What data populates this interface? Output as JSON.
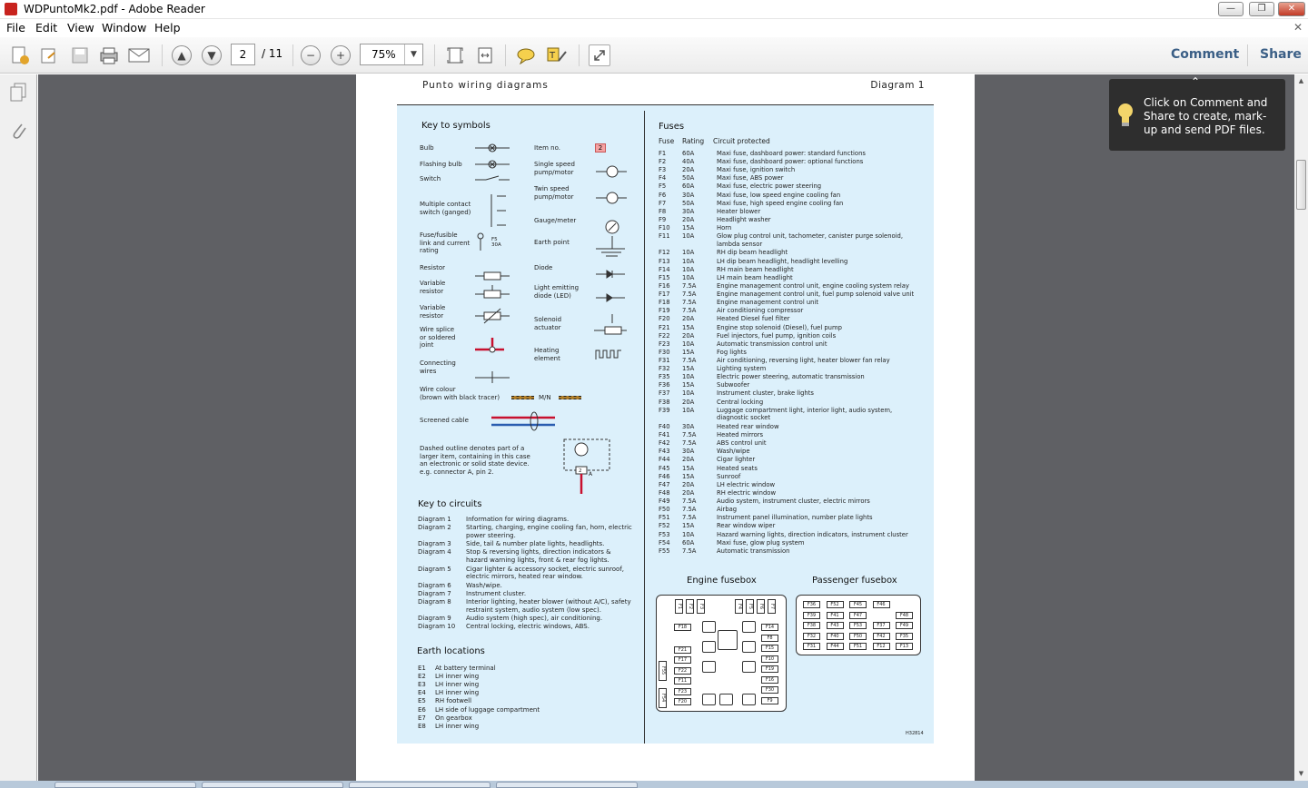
{
  "window": {
    "title": "WDPuntoMk2.pdf - Adobe Reader"
  },
  "menu": [
    "File",
    "Edit",
    "View",
    "Window",
    "Help"
  ],
  "toolbar": {
    "page_current": "2",
    "page_total": "/ 11",
    "zoom": "75%",
    "comment_label": "Comment",
    "share_label": "Share"
  },
  "tooltip": {
    "text": "Click on Comment and Share to create, mark-up and send PDF files."
  },
  "doc": {
    "header_left": "Punto  wiring  diagrams",
    "header_right": "Diagram 1",
    "key_symbols_title": "Key to symbols",
    "symbols_left": [
      "Bulb",
      "Flashing bulb",
      "Switch",
      "Multiple contact\nswitch (ganged)",
      "Fuse/fusible\nlink and current\nrating",
      "Resistor",
      "Variable\nresistor",
      "Variable\nresistor",
      "Wire splice\nor soldered\njoint",
      "Connecting\nwires",
      "Wire colour\n(brown with black tracer)",
      "Screened cable"
    ],
    "symbols_right": [
      "Item no.",
      "Single speed\npump/motor",
      "Twin speed\npump/motor",
      "Gauge/meter",
      "Earth point",
      "Diode",
      "Light emitting\ndiode (LED)",
      "Solenoid\nactuator",
      "Heating\nelement"
    ],
    "item_no_badge": "2",
    "fuse_symbol_label": "F5\n30A",
    "wire_colour_code": "M/N",
    "dashed_note": "Dashed outline denotes part of a\nlarger item, containing in this case\nan electronic or solid state device.\ne.g. connector A, pin 2.",
    "connector_pin": "2",
    "connector_letter": "A",
    "key_circuits_title": "Key to circuits",
    "circuits": [
      {
        "d": "Diagram 1",
        "t": "Information for wiring diagrams."
      },
      {
        "d": "Diagram 2",
        "t": "Starting, charging, engine cooling fan, horn, electric\npower steering."
      },
      {
        "d": "Diagram 3",
        "t": "Side, tail & number plate lights, headlights."
      },
      {
        "d": "Diagram 4",
        "t": "Stop & reversing lights, direction indicators &\nhazard warning lights, front & rear fog lights."
      },
      {
        "d": "Diagram 5",
        "t": "Cigar lighter & accessory socket, electric sunroof,\nelectric mirrors, heated rear window."
      },
      {
        "d": "Diagram 6",
        "t": "Wash/wipe."
      },
      {
        "d": "Diagram 7",
        "t": "Instrument cluster."
      },
      {
        "d": "Diagram 8",
        "t": "Interior lighting, heater blower (without A/C), safety\nrestraint system, audio system (low spec)."
      },
      {
        "d": "Diagram 9",
        "t": "Audio system (high spec), air conditioning."
      },
      {
        "d": "Diagram 10",
        "t": "Central locking, electric windows, ABS."
      }
    ],
    "earth_title": "Earth locations",
    "earths": [
      {
        "e": "E1",
        "t": "At battery terminal"
      },
      {
        "e": "E2",
        "t": "LH inner wing"
      },
      {
        "e": "E3",
        "t": "LH inner wing"
      },
      {
        "e": "E4",
        "t": "LH inner wing"
      },
      {
        "e": "E5",
        "t": "RH footwell"
      },
      {
        "e": "E6",
        "t": "LH side of luggage compartment"
      },
      {
        "e": "E7",
        "t": "On gearbox"
      },
      {
        "e": "E8",
        "t": "LH inner wing"
      }
    ],
    "fuses_title": "Fuses",
    "fuse_headers": [
      "Fuse",
      "Rating",
      "Circuit protected"
    ],
    "fuses": [
      [
        "F1",
        "60A",
        "Maxi fuse, dashboard power: standard functions"
      ],
      [
        "F2",
        "40A",
        "Maxi fuse, dashboard power: optional functions"
      ],
      [
        "F3",
        "20A",
        "Maxi fuse, ignition switch"
      ],
      [
        "F4",
        "50A",
        "Maxi fuse, ABS power"
      ],
      [
        "F5",
        "60A",
        "Maxi fuse, electric power steering"
      ],
      [
        "F6",
        "30A",
        "Maxi fuse, low speed engine cooling fan"
      ],
      [
        "F7",
        "50A",
        "Maxi fuse, high speed engine cooling fan"
      ],
      [
        "F8",
        "30A",
        "Heater blower"
      ],
      [
        "F9",
        "20A",
        "Headlight washer"
      ],
      [
        "F10",
        "15A",
        "Horn"
      ],
      [
        "F11",
        "10A",
        "Glow plug control unit, tachometer, canister purge solenoid,\nlambda sensor"
      ],
      [
        "F12",
        "10A",
        "RH dip beam headlight"
      ],
      [
        "F13",
        "10A",
        "LH dip beam headlight, headlight levelling"
      ],
      [
        "F14",
        "10A",
        "RH main beam headlight"
      ],
      [
        "F15",
        "10A",
        "LH main beam headlight"
      ],
      [
        "F16",
        "7.5A",
        "Engine management control unit, engine cooling system relay"
      ],
      [
        "F17",
        "7.5A",
        "Engine management control unit, fuel pump solenoid valve unit"
      ],
      [
        "F18",
        "7.5A",
        "Engine management control unit"
      ],
      [
        "F19",
        "7.5A",
        "Air conditioning compressor"
      ],
      [
        "F20",
        "20A",
        "Heated Diesel fuel filter"
      ],
      [
        "F21",
        "15A",
        "Engine stop solenoid (Diesel), fuel pump"
      ],
      [
        "F22",
        "20A",
        "Fuel injectors, fuel pump, ignition coils"
      ],
      [
        "F23",
        "10A",
        "Automatic transmission control unit"
      ],
      [
        "F30",
        "15A",
        "Fog lights"
      ],
      [
        "F31",
        "7.5A",
        "Air conditioning, reversing light, heater blower fan relay"
      ],
      [
        "F32",
        "15A",
        "Lighting system"
      ],
      [
        "F35",
        "10A",
        "Electric power steering, automatic transmission"
      ],
      [
        "F36",
        "15A",
        "Subwoofer"
      ],
      [
        "F37",
        "10A",
        "Instrument cluster, brake lights"
      ],
      [
        "F38",
        "20A",
        "Central locking"
      ],
      [
        "F39",
        "10A",
        "Luggage compartment light, interior light, audio system,\ndiagnostic socket"
      ],
      [
        "F40",
        "30A",
        "Heated rear window"
      ],
      [
        "F41",
        "7.5A",
        "Heated mirrors"
      ],
      [
        "F42",
        "7.5A",
        "ABS control unit"
      ],
      [
        "F43",
        "30A",
        "Wash/wipe"
      ],
      [
        "F44",
        "20A",
        "Cigar lighter"
      ],
      [
        "F45",
        "15A",
        "Heated seats"
      ],
      [
        "F46",
        "15A",
        "Sunroof"
      ],
      [
        "F47",
        "20A",
        "LH electric window"
      ],
      [
        "F48",
        "20A",
        "RH electric window"
      ],
      [
        "F49",
        "7.5A",
        "Audio system, instrument cluster, electric mirrors"
      ],
      [
        "F50",
        "7.5A",
        "Airbag"
      ],
      [
        "F51",
        "7.5A",
        "Instrument panel illumination, number plate lights"
      ],
      [
        "F52",
        "15A",
        "Rear window wiper"
      ],
      [
        "F53",
        "10A",
        "Hazard warning lights, direction indicators, instrument cluster"
      ],
      [
        "F54",
        "60A",
        "Maxi fuse, glow plug system"
      ],
      [
        "F55",
        "7.5A",
        "Automatic transmission"
      ]
    ],
    "engine_fusebox_title": "Engine fusebox",
    "passenger_fusebox_title": "Passenger fusebox",
    "engine_top_fuses": [
      "F1",
      "F2",
      "F3",
      "F4",
      "F5",
      "F6",
      "F7"
    ],
    "engine_left_fuses": [
      "F18",
      "F21",
      "F17",
      "F22",
      "F11",
      "F23",
      "F20"
    ],
    "engine_right_fuses": [
      "F14",
      "F8",
      "F15",
      "F10",
      "F19",
      "F16",
      "F30",
      "F9"
    ],
    "engine_side_fuses": [
      "F55",
      "F54"
    ],
    "passenger_rows": [
      [
        "F36",
        "F52",
        "F45",
        "F46",
        ""
      ],
      [
        "F39",
        "F41",
        "F47",
        "",
        "F48"
      ],
      [
        "F38",
        "F43",
        "F53",
        "F37",
        "F49"
      ],
      [
        "F32",
        "F40",
        "F50",
        "F42",
        "F35"
      ],
      [
        "F31",
        "F44",
        "F51",
        "F12",
        "F13"
      ]
    ],
    "ref_code": "H32814"
  }
}
